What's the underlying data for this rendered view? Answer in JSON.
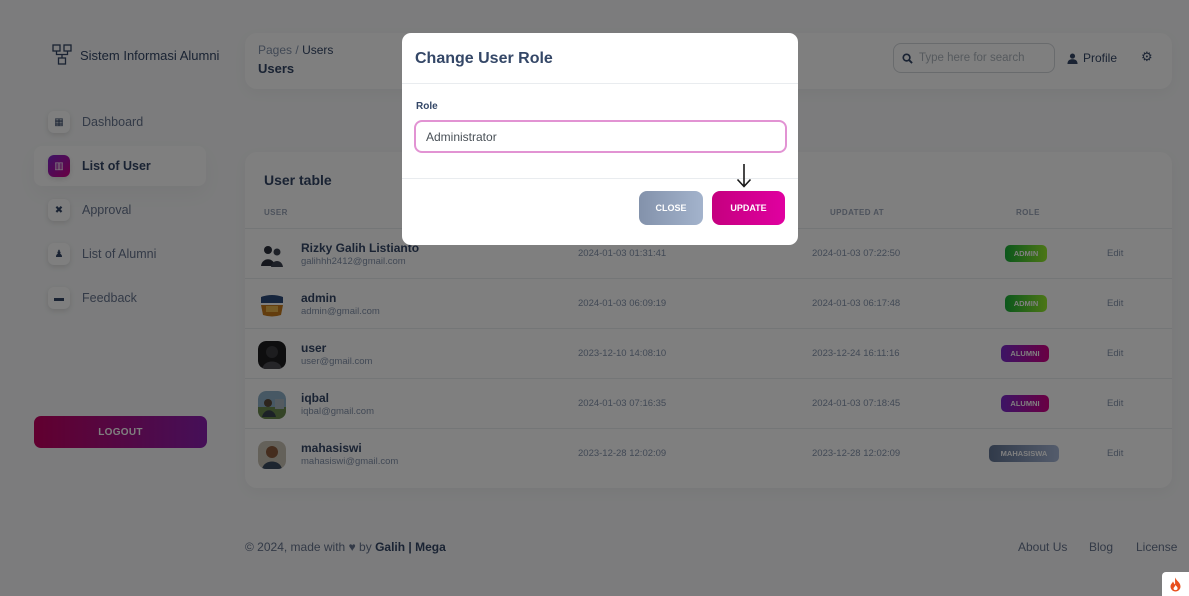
{
  "brand": {
    "name": "Sistem Informasi Alumni",
    "icon": "sitemap-icon"
  },
  "sidebar": {
    "items": [
      {
        "label": "Dashboard",
        "icon": "store-icon",
        "active": false
      },
      {
        "label": "List of User",
        "icon": "chart-icon",
        "active": true
      },
      {
        "label": "Approval",
        "icon": "tools-icon",
        "active": false
      },
      {
        "label": "List of Alumni",
        "icon": "user-icon",
        "active": false
      },
      {
        "label": "Feedback",
        "icon": "wallet-icon",
        "active": false
      }
    ],
    "logout_label": "LOGOUT"
  },
  "navbar": {
    "breadcrumb_parent": "Pages",
    "breadcrumb_separator": "/",
    "breadcrumb_current": "Users",
    "page_title": "Users",
    "search_placeholder": "Type here for search",
    "profile_label": "Profile"
  },
  "table": {
    "title": "User table",
    "headers": {
      "user": "USER",
      "updated_at": "UPDATED AT",
      "role": "ROLE"
    },
    "rows": [
      {
        "name": "Rizky Galih Listianto",
        "email": "galihhh2412@gmail.com",
        "created": "2024-01-03 01:31:41",
        "updated": "2024-01-03 07:22:50",
        "role": "ADMIN",
        "action": "Edit"
      },
      {
        "name": "admin",
        "email": "admin@gmail.com",
        "created": "2024-01-03 06:09:19",
        "updated": "2024-01-03 06:17:48",
        "role": "ADMIN",
        "action": "Edit"
      },
      {
        "name": "user",
        "email": "user@gmail.com",
        "created": "2023-12-10 14:08:10",
        "updated": "2023-12-24 16:11:16",
        "role": "ALUMNI",
        "action": "Edit"
      },
      {
        "name": "iqbal",
        "email": "iqbal@gmail.com",
        "created": "2024-01-03 07:16:35",
        "updated": "2024-01-03 07:18:45",
        "role": "ALUMNI",
        "action": "Edit"
      },
      {
        "name": "mahasiswi",
        "email": "mahasiswi@gmail.com",
        "created": "2023-12-28 12:02:09",
        "updated": "2023-12-28 12:02:09",
        "role": "MAHASISWA",
        "action": "Edit"
      }
    ]
  },
  "footer": {
    "prefix": "© 2024, made with",
    "by": "by",
    "authors": "Galih | Mega",
    "links": [
      "About Us",
      "Blog",
      "License"
    ]
  },
  "modal": {
    "title": "Change User Role",
    "role_label": "Role",
    "role_value": "Administrator",
    "close_label": "CLOSE",
    "update_label": "UPDATE"
  },
  "colors": {
    "accent_gradient_start": "#7928ca",
    "accent_gradient_end": "#d30086",
    "admin_badge": "#17ad37",
    "mahasiswa_badge": "#627594",
    "text_dark": "#344767",
    "text_muted": "#8392ab"
  }
}
